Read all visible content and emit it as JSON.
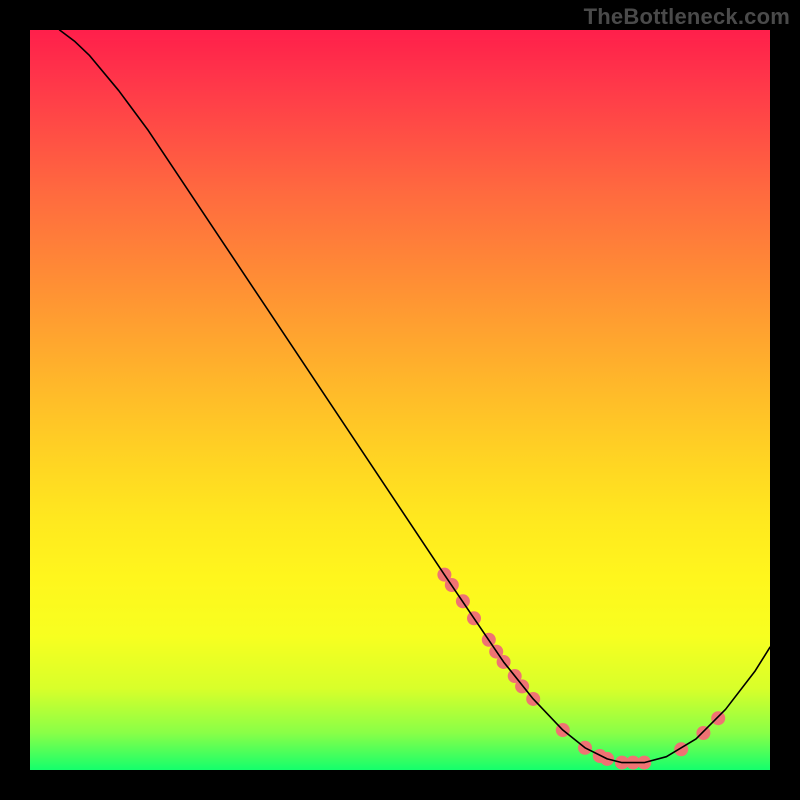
{
  "watermark": "TheBottleneck.com",
  "chart_data": {
    "type": "line",
    "title": "",
    "xlabel": "",
    "ylabel": "",
    "xlim": [
      0,
      100
    ],
    "ylim": [
      0,
      100
    ],
    "grid": false,
    "legend": false,
    "series": [
      {
        "name": "curve",
        "x": [
          4,
          6,
          8,
          12,
          16,
          20,
          26,
          32,
          38,
          44,
          50,
          56,
          60,
          64,
          68,
          72,
          75,
          78,
          80,
          83,
          86,
          90,
          94,
          98,
          100
        ],
        "y": [
          100,
          98.5,
          96.6,
          91.8,
          86.4,
          80.4,
          71.4,
          62.4,
          53.4,
          44.4,
          35.4,
          26.4,
          20.5,
          14.6,
          9.6,
          5.4,
          3.0,
          1.5,
          1.0,
          1.0,
          1.8,
          4.2,
          8.2,
          13.4,
          16.6
        ],
        "color": "#000000",
        "line_width": 1.6
      }
    ],
    "scatter_points": [
      {
        "x": 56.0,
        "y": 26.4
      },
      {
        "x": 57.0,
        "y": 25.0
      },
      {
        "x": 58.5,
        "y": 22.8
      },
      {
        "x": 60.0,
        "y": 20.5
      },
      {
        "x": 62.0,
        "y": 17.6
      },
      {
        "x": 63.0,
        "y": 16.0
      },
      {
        "x": 64.0,
        "y": 14.6
      },
      {
        "x": 65.5,
        "y": 12.7
      },
      {
        "x": 66.5,
        "y": 11.3
      },
      {
        "x": 68.0,
        "y": 9.6
      },
      {
        "x": 72.0,
        "y": 5.4
      },
      {
        "x": 75.0,
        "y": 3.0
      },
      {
        "x": 77.0,
        "y": 1.9
      },
      {
        "x": 78.0,
        "y": 1.5
      },
      {
        "x": 80.0,
        "y": 1.0
      },
      {
        "x": 81.5,
        "y": 1.0
      },
      {
        "x": 83.0,
        "y": 1.0
      },
      {
        "x": 88.0,
        "y": 2.8
      },
      {
        "x": 91.0,
        "y": 5.0
      },
      {
        "x": 93.0,
        "y": 7.0
      }
    ],
    "scatter_color": "#ef7373",
    "scatter_radius": 7
  }
}
